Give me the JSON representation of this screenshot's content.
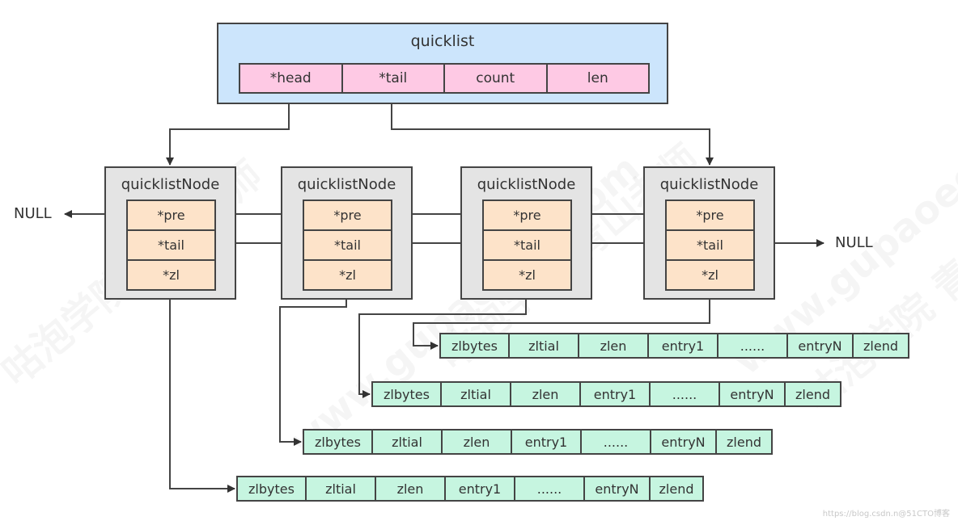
{
  "quicklist": {
    "title": "quicklist",
    "fields": [
      "*head",
      "*tail",
      "count",
      "len"
    ]
  },
  "nodes": [
    {
      "title": "quicklistNode",
      "fields": [
        "*pre",
        "*tail",
        "*zl"
      ]
    },
    {
      "title": "quicklistNode",
      "fields": [
        "*pre",
        "*tail",
        "*zl"
      ]
    },
    {
      "title": "quicklistNode",
      "fields": [
        "*pre",
        "*tail",
        "*zl"
      ]
    },
    {
      "title": "quicklistNode",
      "fields": [
        "*pre",
        "*tail",
        "*zl"
      ]
    }
  ],
  "null_left": "NULL",
  "null_right": "NULL",
  "ziplists": [
    {
      "cells": [
        "zlbytes",
        "zltial",
        "zlen",
        "entry1",
        "......",
        "entryN",
        "zlend"
      ]
    },
    {
      "cells": [
        "zlbytes",
        "zltial",
        "zlen",
        "entry1",
        "......",
        "entryN",
        "zlend"
      ]
    },
    {
      "cells": [
        "zlbytes",
        "zltial",
        "zlen",
        "entry1",
        "......",
        "entryN",
        "zlend"
      ]
    },
    {
      "cells": [
        "zlbytes",
        "zltial",
        "zlen",
        "entry1",
        "......",
        "entryN",
        "zlend"
      ]
    }
  ],
  "watermark": {
    "text_1": "咕泡学院 青山老师",
    "text_2": "www.gupaoedu.com"
  },
  "footer": "https://blog.csdn.n@51CTO博客",
  "colors": {
    "quicklist_bg": "#cce5fc",
    "quicklist_field": "#fec9e4",
    "node_bg": "#e4e4e4",
    "node_field": "#fde3c9",
    "ziplist_cell": "#c6f5e0",
    "stroke": "#444444"
  }
}
